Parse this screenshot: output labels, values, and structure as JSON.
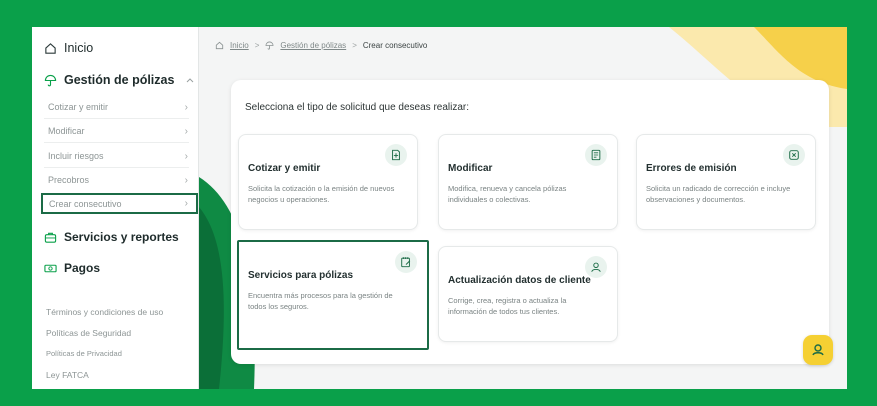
{
  "sidebar": {
    "inicio": "Inicio",
    "gestion": "Gestión de pólizas",
    "sub_items": [
      {
        "label": "Cotizar y emitir"
      },
      {
        "label": "Modificar"
      },
      {
        "label": "Incluir riesgos"
      },
      {
        "label": "Precobros"
      },
      {
        "label": "Crear consecutivo"
      }
    ],
    "servicios": "Servicios y reportes",
    "pagos": "Pagos",
    "footer_links": [
      {
        "label": "Términos y condiciones de uso"
      },
      {
        "label": "Políticas de Seguridad"
      },
      {
        "label": "Políticas de Privacidad"
      },
      {
        "label": "Ley FATCA"
      }
    ]
  },
  "breadcrumb": {
    "items": [
      "Inicio",
      "Gestión de pólizas",
      "Crear consecutivo"
    ],
    "separator": ">"
  },
  "main": {
    "panel_title": "Selecciona el tipo de solicitud que deseas realizar:",
    "cards": [
      {
        "title": "Cotizar y emitir",
        "desc": "Solicita la cotización o la emisión de nuevos negocios u operaciones.",
        "icon": "document-add-icon"
      },
      {
        "title": "Modificar",
        "desc": "Modifica, renueva y cancela pólizas individuales o colectivas.",
        "icon": "document-edit-icon"
      },
      {
        "title": "Errores de emisión",
        "desc": "Solicita un radicado de corrección e incluye observaciones y documentos.",
        "icon": "error-fix-icon"
      },
      {
        "title": "Servicios para pólizas",
        "desc": "Encuentra más procesos para la gestión de todos los seguros.",
        "icon": "notepad-pencil-icon"
      },
      {
        "title": "Actualización datos de cliente",
        "desc": "Corrige, crea, registra o actualiza la información de todos tus clientes.",
        "icon": "user-icon"
      }
    ]
  },
  "colors": {
    "brand_green": "#0aa04a",
    "accent_dark_green": "#1b6b46",
    "accent_yellow": "#f5d033",
    "icon_bg": "#e9f3ee"
  }
}
